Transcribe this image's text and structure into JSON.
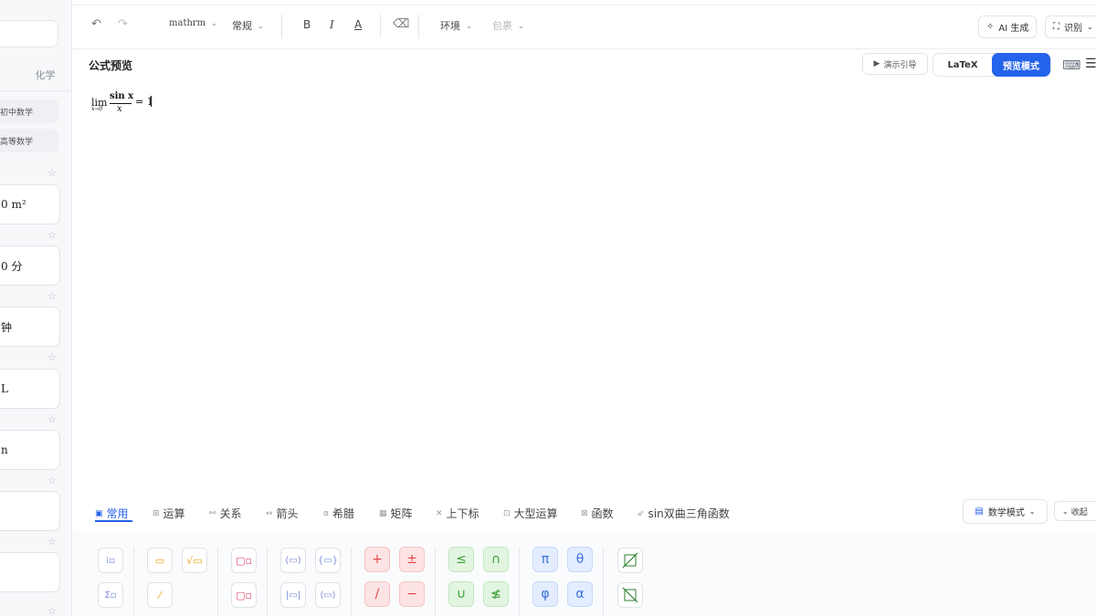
{
  "sidebar": {
    "tab_label": "化学",
    "chips": [
      "初中数学",
      "高等数学"
    ],
    "cards": [
      "0 m²",
      "0 分",
      "钟",
      "L",
      "n",
      "",
      ""
    ],
    "star": "☆"
  },
  "toolbar": {
    "font_style": "mathrm",
    "size": "常规",
    "bold": "B",
    "italic": "I",
    "color": "A",
    "environment": "环境",
    "wrap": "包裹",
    "ai_generate": "AI 生成",
    "recognize": "识别"
  },
  "preview": {
    "title": "公式预览",
    "demo_button": "演示引导",
    "latex_tab": "LaTeX",
    "preview_tab": "预览模式"
  },
  "formula": {
    "lim": "lim",
    "sub": "x→0",
    "numerator": "sin x",
    "denominator": "x",
    "rhs": "= 1"
  },
  "bottom_tabs": {
    "tabs": [
      {
        "label": "常用",
        "icon": "▣"
      },
      {
        "label": "运算",
        "icon": "⊞"
      },
      {
        "label": "关系",
        "icon": "⚯"
      },
      {
        "label": "箭头",
        "icon": "↔"
      },
      {
        "label": "希腊",
        "icon": "α"
      },
      {
        "label": "矩阵",
        "icon": "▦"
      },
      {
        "label": "上下标",
        "icon": "✕"
      },
      {
        "label": "大型运算",
        "icon": "⊡"
      },
      {
        "label": "函数",
        "icon": "⊠"
      },
      {
        "label": "sin双曲三角函数",
        "icon": "⇙"
      }
    ],
    "mode_button": "数学模式",
    "collapse_button": "收起"
  },
  "palette": {
    "symbols": [
      "+",
      "±",
      "/",
      "−",
      "≤",
      "∩",
      "∪",
      "≰",
      "π",
      "θ",
      "φ",
      "α"
    ]
  },
  "colors": {
    "accent": "#2563eb"
  }
}
